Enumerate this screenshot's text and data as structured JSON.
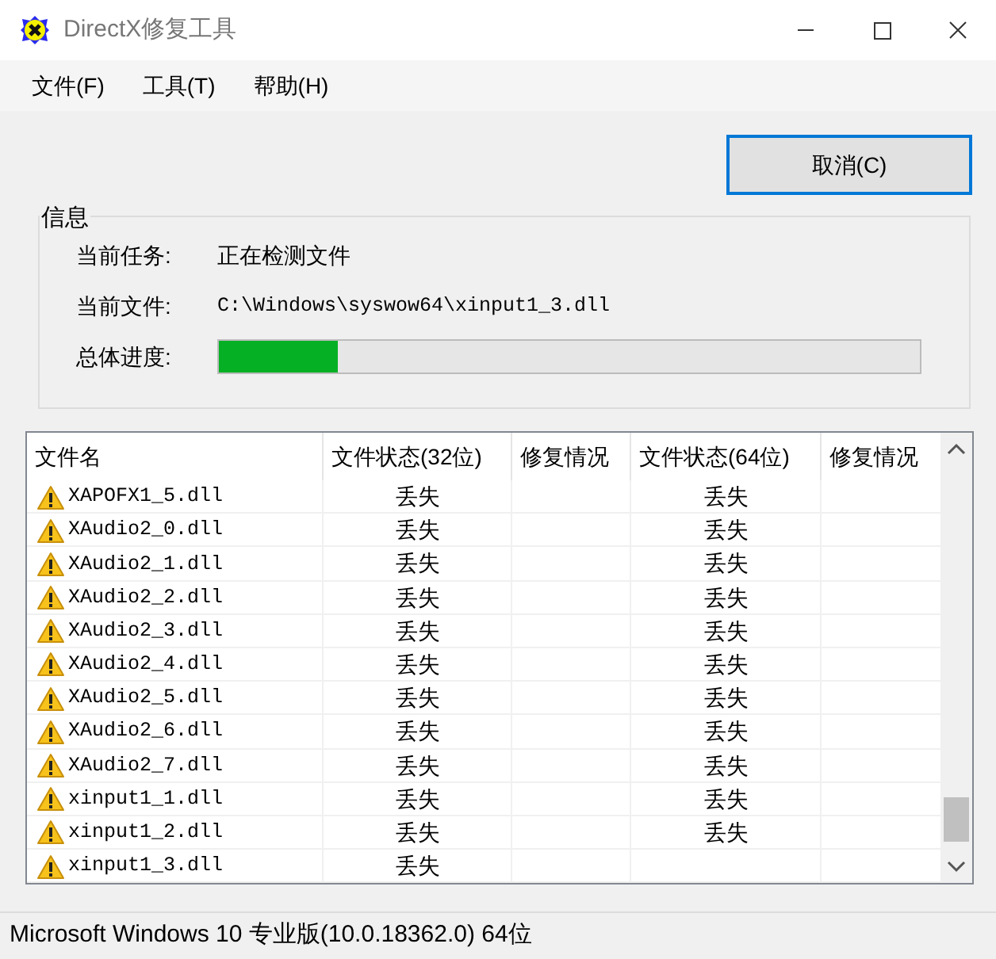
{
  "window": {
    "title": "DirectX修复工具"
  },
  "menu": [
    "文件(F)",
    "工具(T)",
    "帮助(H)"
  ],
  "cancel_button": "取消(C)",
  "info": {
    "title": "信息",
    "fields": [
      {
        "label": "当前任务:",
        "value": "正在检测文件",
        "kind": "text"
      },
      {
        "label": "当前文件:",
        "value": "C:\\Windows\\syswow64\\xinput1_3.dll",
        "kind": "mono"
      },
      {
        "label": "总体进度:",
        "kind": "progress",
        "level": 0.17
      }
    ]
  },
  "table": {
    "columns": [
      "文件名",
      "文件状态(32位)",
      "修复情况",
      "文件状态(64位)",
      "修复情况"
    ],
    "rows": [
      {
        "name": "XAPOFX1_5.dll",
        "status_32": "丢失",
        "status_64": "丢失"
      },
      {
        "name": "XAudio2_0.dll",
        "status_32": "丢失",
        "status_64": "丢失"
      },
      {
        "name": "XAudio2_1.dll",
        "status_32": "丢失",
        "status_64": "丢失"
      },
      {
        "name": "XAudio2_2.dll",
        "status_32": "丢失",
        "status_64": "丢失"
      },
      {
        "name": "XAudio2_3.dll",
        "status_32": "丢失",
        "status_64": "丢失"
      },
      {
        "name": "XAudio2_4.dll",
        "status_32": "丢失",
        "status_64": "丢失"
      },
      {
        "name": "XAudio2_5.dll",
        "status_32": "丢失",
        "status_64": "丢失"
      },
      {
        "name": "XAudio2_6.dll",
        "status_32": "丢失",
        "status_64": "丢失"
      },
      {
        "name": "XAudio2_7.dll",
        "status_32": "丢失",
        "status_64": "丢失"
      },
      {
        "name": "xinput1_1.dll",
        "status_32": "丢失",
        "status_64": "丢失"
      },
      {
        "name": "xinput1_2.dll",
        "status_32": "丢失",
        "status_64": "丢失"
      },
      {
        "name": "xinput1_3.dll",
        "status_32": "丢失"
      }
    ]
  },
  "status_bar": "Microsoft Windows 10 专业版(10.0.18362.0) 64位"
}
